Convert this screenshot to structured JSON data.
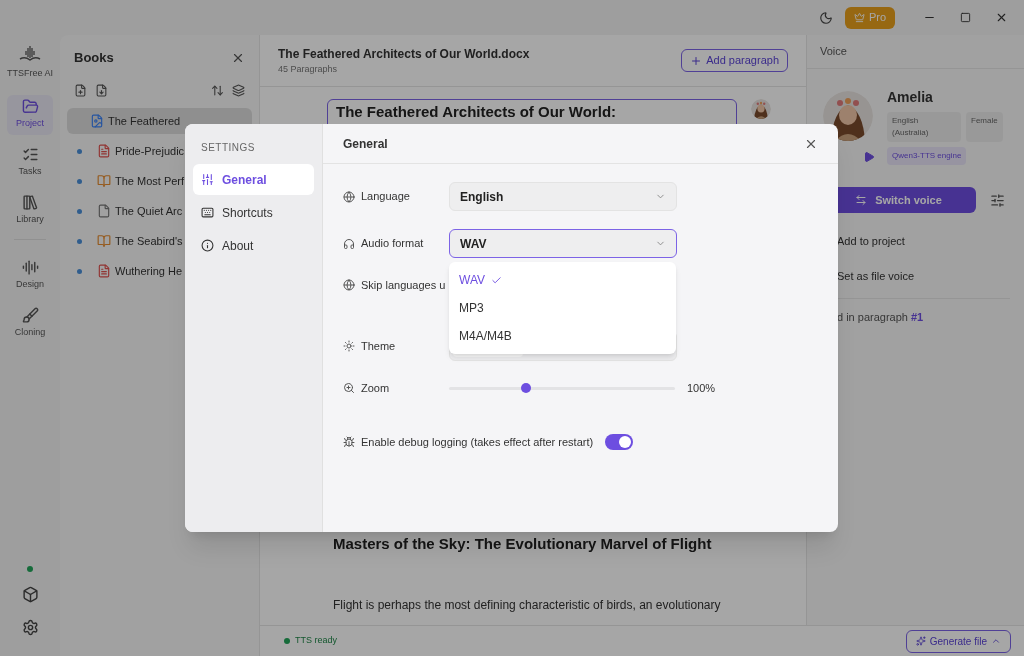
{
  "titlebar": {
    "pro_label": "Pro"
  },
  "rail": {
    "logo_label": "TTSFree AI",
    "items": [
      {
        "label": "Project",
        "selected": true
      },
      {
        "label": "Tasks",
        "selected": false
      },
      {
        "label": "Library",
        "selected": false
      },
      {
        "label": "Design",
        "selected": false
      },
      {
        "label": "Cloning",
        "selected": false
      }
    ],
    "online": true
  },
  "books": {
    "title": "Books",
    "items": [
      {
        "title": "The Feathered",
        "kind": "docx",
        "selected": true
      },
      {
        "title": "Pride-Prejudic",
        "kind": "pdf",
        "selected": false
      },
      {
        "title": "The Most Perf",
        "kind": "book",
        "selected": false
      },
      {
        "title": "The Quiet Arc",
        "kind": "text",
        "selected": false
      },
      {
        "title": "The Seabird's",
        "kind": "book",
        "selected": false
      },
      {
        "title": "Wuthering He",
        "kind": "pdf",
        "selected": false
      }
    ]
  },
  "document": {
    "title": "The Feathered Architects of Our World.docx",
    "subtitle": "45 Paragraphs",
    "add_button": "Add paragraph",
    "heading": "The Feathered Architects of Our World:",
    "section_heading": "Masters of the Sky: The Evolutionary Marvel of Flight",
    "paragraph": "Flight is perhaps the most defining characteristic of birds, an evolutionary"
  },
  "status_bar": {
    "status": "TTS ready",
    "generate_button": "Generate file"
  },
  "voice": {
    "title": "Voice",
    "name": "Amelia",
    "tags": [
      {
        "label": "English (Australia)",
        "kind": "plain"
      },
      {
        "label": "Female",
        "kind": "plain"
      },
      {
        "label": "Qwen3-TTS engine",
        "kind": "engine"
      }
    ],
    "switch_button": "Switch voice",
    "actions": [
      "Add to project",
      "Set as file voice"
    ],
    "usage": "d in paragraph **#1**"
  },
  "settings": {
    "heading": "SETTINGS",
    "nav": [
      {
        "label": "General",
        "selected": true
      },
      {
        "label": "Shortcuts",
        "selected": false
      },
      {
        "label": "About",
        "selected": false
      }
    ],
    "title": "General",
    "rows": [
      {
        "kind": "select",
        "label": "Language",
        "value": "English",
        "focused": false
      },
      {
        "kind": "select",
        "label": "Audio format",
        "value": "WAV",
        "focused": true
      },
      {
        "kind": "multi",
        "label": "Skip languages u"
      },
      {
        "kind": "segmented",
        "label": "Theme"
      },
      {
        "kind": "slider",
        "label": "Zoom",
        "level": 0.34,
        "reading": "100%"
      },
      {
        "kind": "toggle",
        "label": "Enable debug logging (takes effect after restart)",
        "on": true
      }
    ],
    "dropdown": {
      "options": [
        {
          "label": "WAV",
          "selected": true
        },
        {
          "label": "MP3",
          "selected": false
        },
        {
          "label": "M4A/M4B",
          "selected": false
        }
      ]
    }
  }
}
